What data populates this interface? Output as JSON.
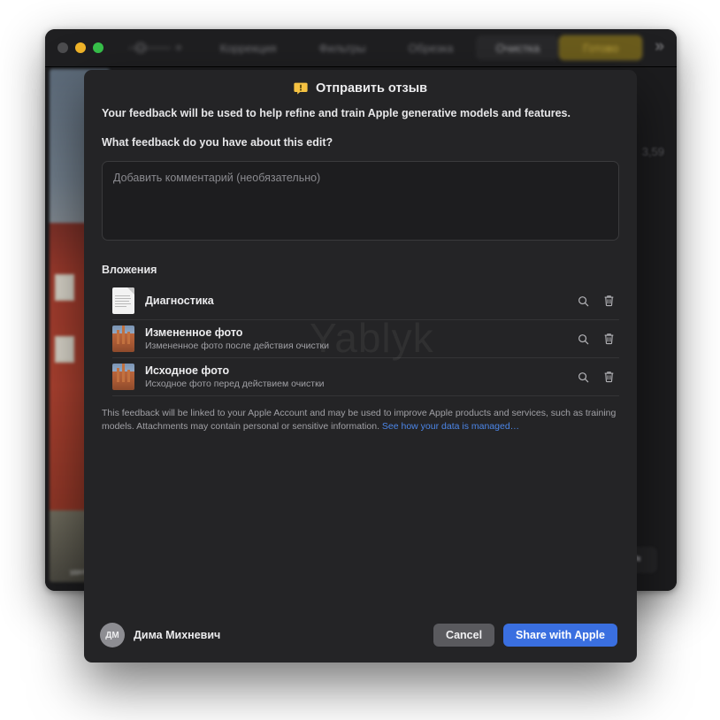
{
  "background_window": {
    "traffic_lights": [
      "close",
      "minimize",
      "zoom"
    ],
    "toolbar_tabs": [
      {
        "label": "Коррекция",
        "active": false
      },
      {
        "label": "Фильтры",
        "active": false
      },
      {
        "label": "Обрезка",
        "active": false
      },
      {
        "label": "Очистка",
        "active": true
      }
    ],
    "done_button": "Готово",
    "overflow_icon": "»",
    "photo_caption": "удаль",
    "badge_number": "3,59",
    "corner_icon": "tag-icon"
  },
  "watermark": "Yablyk",
  "sheet": {
    "title": "Отправить отзыв",
    "title_icon": "feedback-bubble-icon",
    "intro": "Your feedback will be used to help refine and train Apple generative models and features.",
    "question": "What feedback do you have about this edit?",
    "comment_placeholder": "Добавить комментарий (необязательно)",
    "comment_value": "",
    "attachments_title": "Вложения",
    "attachments": [
      {
        "name": "Диагностика",
        "subtitle": "",
        "icon": "document-icon",
        "view_action": "magnifier-icon",
        "delete_action": "trash-icon"
      },
      {
        "name": "Измененное фото",
        "subtitle": "Измененное фото после действия очистки",
        "icon": "photo-icon",
        "view_action": "magnifier-icon",
        "delete_action": "trash-icon"
      },
      {
        "name": "Исходное фото",
        "subtitle": "Исходное фото перед действием очистки",
        "icon": "photo-icon",
        "view_action": "magnifier-icon",
        "delete_action": "trash-icon"
      }
    ],
    "legal_text": "This feedback will be linked to your Apple Account and may be used to improve Apple products and services, such as training models. Attachments may contain personal or sensitive information. ",
    "legal_link": "See how your data is managed…",
    "footer": {
      "avatar_initials": "ДМ",
      "user_name": "Дима Михневич",
      "cancel_label": "Cancel",
      "share_label": "Share with Apple"
    }
  },
  "colors": {
    "sheet_bg": "#242426",
    "window_bg": "#1c1c1e",
    "accent_blue": "#3a6fe0",
    "link_blue": "#4c86e8",
    "done_yellow": "#6b5c1c",
    "bubble_yellow": "#f5c242"
  }
}
